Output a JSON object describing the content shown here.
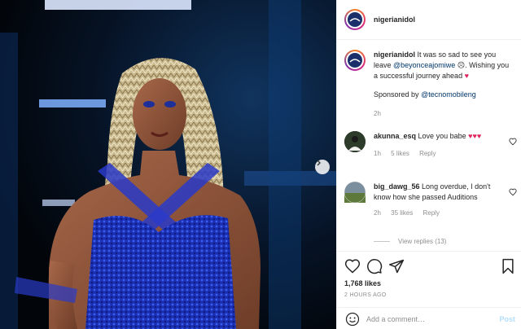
{
  "post": {
    "username": "nigerianidol",
    "caption": {
      "username": "nigerianidol",
      "text_1": "It was so sad to see you leave",
      "mention_1": "@beyonceajomiwe",
      "text_2": ". Wishing you a successful journey ahead",
      "sponsor_text": "Sponsored by",
      "mention_2": "@tecnomobileng",
      "time": "2h"
    },
    "likes": "1,768 likes",
    "posted": "2 HOURS AGO"
  },
  "comments": [
    {
      "username": "akunna_esq",
      "text": "Love you babe",
      "time": "1h",
      "likes": "5 likes",
      "reply": "Reply"
    },
    {
      "username": "big_dawg_56",
      "text": "Long overdue, I don't know how she passed Auditions",
      "time": "2h",
      "likes": "35 likes",
      "reply": "Reply"
    }
  ],
  "view_replies": "View replies (13)",
  "add_comment": {
    "placeholder": "Add a comment…",
    "post_label": "Post"
  },
  "icons": {
    "next": "chevron-right-icon",
    "like": "heart-outline-icon",
    "comment": "speech-bubble-icon",
    "share": "paper-plane-icon",
    "save": "bookmark-icon",
    "emoji": "smiley-icon"
  },
  "colors": {
    "link": "#00376b",
    "heart": "#e0245e",
    "post_button": "#b2dffc",
    "muted": "#8e8e8e"
  }
}
